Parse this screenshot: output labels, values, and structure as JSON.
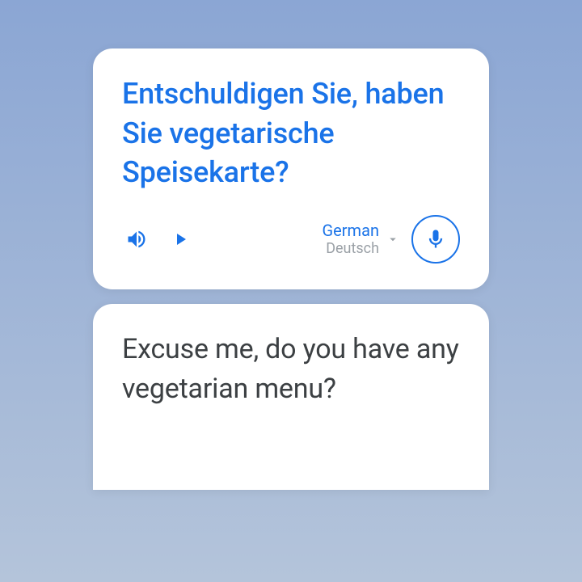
{
  "source": {
    "text": "Entschuldigen Sie, haben Sie vegetarische Speisekarte?",
    "language_primary": "German",
    "language_secondary": "Deutsch"
  },
  "target": {
    "text": "Excuse me, do you have any vegetarian menu?"
  },
  "colors": {
    "accent": "#1a73e8",
    "muted": "#9aa0a6",
    "text": "#3c4043"
  }
}
